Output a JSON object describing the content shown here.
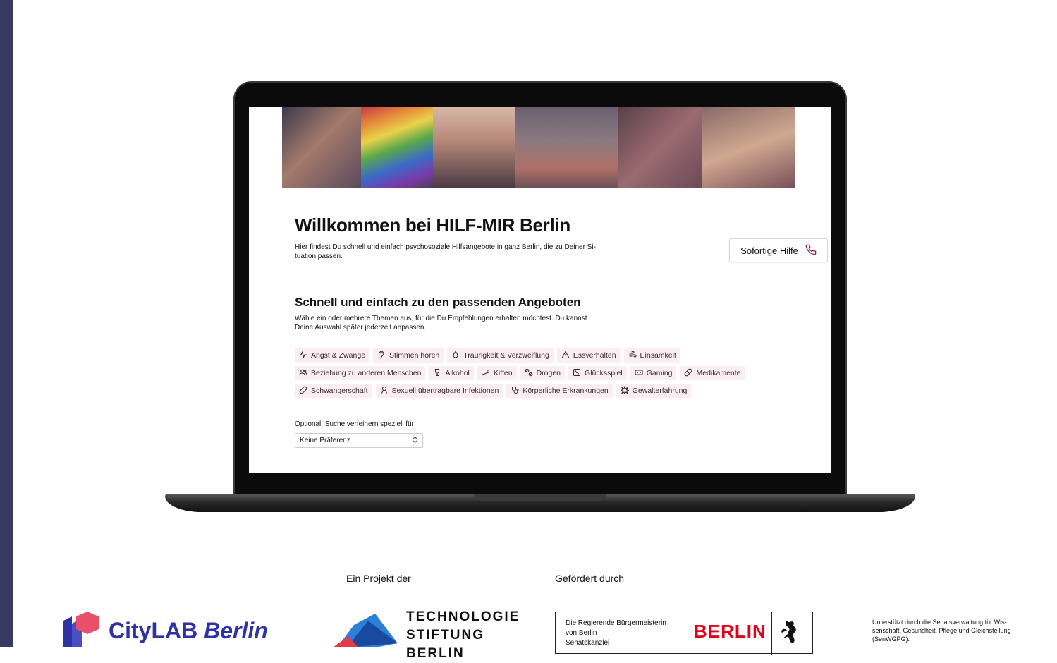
{
  "hero": {
    "photos": [
      "hands-reaching",
      "rainbow-flag",
      "friends-embracing",
      "street-help",
      "holding-hands",
      "woman-window"
    ]
  },
  "welcome": {
    "title": "Willkommen bei HILF-MIR Berlin",
    "subtitle": "Hier findest Du schnell und einfach psychosoziale Hilfsangebote in ganz Berlin, die zu Deiner Si-tuation passen."
  },
  "help_button": {
    "label": "Sofortige Hilfe",
    "icon": "phone-icon"
  },
  "section": {
    "title": "Schnell und einfach zu den passenden Angeboten",
    "subtitle": "Wähle ein oder mehrere Themen aus, für die Du Empfehlungen erhalten möchtest. Du kannst Deine Auswahl später jederzeit anpassen."
  },
  "topics": [
    {
      "label": "Angst & Zwänge",
      "icon": "pulse-icon"
    },
    {
      "label": "Stimmen hören",
      "icon": "ear-icon"
    },
    {
      "label": "Traurigkeit & Verzweiflung",
      "icon": "drop-icon"
    },
    {
      "label": "Essverhalten",
      "icon": "triangle-icon"
    },
    {
      "label": "Einsamkeit",
      "icon": "wind-icon"
    },
    {
      "label": "Beziehung zu anderen Menschen",
      "icon": "people-icon"
    },
    {
      "label": "Alkohol",
      "icon": "wine-icon"
    },
    {
      "label": "Kiffen",
      "icon": "joint-icon"
    },
    {
      "label": "Drogen",
      "icon": "pills-icon"
    },
    {
      "label": "Glücksspiel",
      "icon": "dice-icon"
    },
    {
      "label": "Gaming",
      "icon": "gamepad-icon"
    },
    {
      "label": "Medikamente",
      "icon": "capsule-icon"
    },
    {
      "label": "Schwangerschaft",
      "icon": "pen-icon"
    },
    {
      "label": "Sexuell übertragbare Infektionen",
      "icon": "ribbon-icon"
    },
    {
      "label": "Körperliche Erkrankungen",
      "icon": "stethoscope-icon"
    },
    {
      "label": "Gewalterfahrung",
      "icon": "burst-icon"
    }
  ],
  "preference": {
    "label": "Optional: Suche verfeinern speziell für:",
    "value": "Keine Präferenz"
  },
  "footer": {
    "project_label": "Ein Projekt der",
    "funded_label": "Gefördert durch",
    "citylab": "CityLAB",
    "citylab_city": "Berlin",
    "tsb_line1": "TECHNOLOGIE",
    "tsb_line2": "STIFTUNG",
    "tsb_line3": "BERLIN",
    "berlin_office_1": "Die Regierende Bürgermeisterin",
    "berlin_office_2": "von Berlin",
    "berlin_office_3": "Senatskanzlei",
    "berlin_word": "BERLIN",
    "senate_note": "Unterstützt durch die Senatsverwaltung für Wis-senschaft, Gesundheit, Pflege und Gleichstellung (SenWGPG)."
  },
  "colors": {
    "sidebar": "#393a63",
    "chip_bg": "#fbeef3",
    "accent": "#8a1d5a",
    "citylab": "#2f32a6",
    "berlin_red": "#e2001a"
  }
}
